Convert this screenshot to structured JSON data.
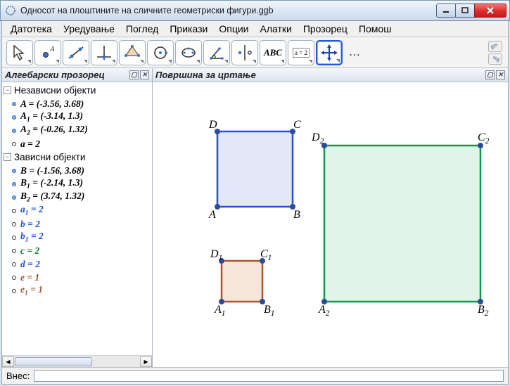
{
  "window": {
    "title": "Односот на плоштините на сличните геометриски фигури.ggb"
  },
  "menu": {
    "file": "Датотека",
    "edit": "Уредување",
    "view": "Поглед",
    "perspectives": "Прикази",
    "options": "Опции",
    "tools": "Алатки",
    "window": "Прозорец",
    "help": "Помош"
  },
  "toolbar": {
    "abc": "ABC",
    "a2": "a = 2",
    "dots": "..."
  },
  "panels": {
    "algebra_title": "Алгебарски прозорец",
    "graphics_title": "Површина за цртање"
  },
  "tree": {
    "independent_label": "Независни објекти",
    "dependent_label": "Зависни објекти",
    "independent": [
      {
        "name": "A",
        "sub": "",
        "text": "A = (-3.56, 3.68)",
        "color": "c-black",
        "dot": "filled"
      },
      {
        "name": "A1",
        "sub": "1",
        "text": "A₁ = (-3.14, 1.3)",
        "raw_name": "A",
        "color": "c-black",
        "dot": "filled"
      },
      {
        "name": "A2",
        "sub": "2",
        "text": "A₂ = (-0.26, 1.32)",
        "raw_name": "A",
        "color": "c-black",
        "dot": "filled"
      },
      {
        "name": "a",
        "sub": "",
        "text": "a = 2",
        "color": "c-black",
        "dot": "hollow"
      }
    ],
    "dependent": [
      {
        "name": "B",
        "sub": "",
        "text": "B = (-1.56, 3.68)",
        "color": "c-black",
        "dot": "filled"
      },
      {
        "name": "B1",
        "sub": "1",
        "text": "B₁ = (-2.14, 1.3)",
        "raw_name": "B",
        "color": "c-black",
        "dot": "filled"
      },
      {
        "name": "B2",
        "sub": "2",
        "text": "B₂ = (3.74, 1.32)",
        "raw_name": "B",
        "color": "c-black",
        "dot": "filled"
      },
      {
        "name": "a1",
        "sub": "1",
        "text": "a₁ = 2",
        "raw_name": "a",
        "color": "c-blue",
        "dot": "hollow"
      },
      {
        "name": "b",
        "sub": "",
        "text": "b = 2",
        "color": "c-blue",
        "dot": "hollow"
      },
      {
        "name": "b1",
        "sub": "1",
        "text": "b₁ = 2",
        "raw_name": "b",
        "color": "c-blue",
        "dot": "hollow"
      },
      {
        "name": "c",
        "sub": "",
        "text": "c = 2",
        "color": "c-green",
        "dot": "hollow"
      },
      {
        "name": "d",
        "sub": "",
        "text": "d = 2",
        "color": "c-blue",
        "dot": "hollow"
      },
      {
        "name": "e",
        "sub": "",
        "text": "e = 1",
        "color": "c-brown",
        "dot": "hollow"
      },
      {
        "name": "e1",
        "sub": "1",
        "text": "e₁ = 1",
        "raw_name": "e",
        "color": "c-brown",
        "dot": "hollow"
      }
    ]
  },
  "inputbar": {
    "label": "Внес:",
    "value": ""
  },
  "canvas": {
    "labels": {
      "A": "A",
      "B": "B",
      "C": "C",
      "D": "D",
      "A1": "A",
      "B1": "B",
      "C1": "C",
      "D1": "D",
      "A2": "A",
      "B2": "B",
      "C2": "C",
      "D2": "D"
    }
  }
}
